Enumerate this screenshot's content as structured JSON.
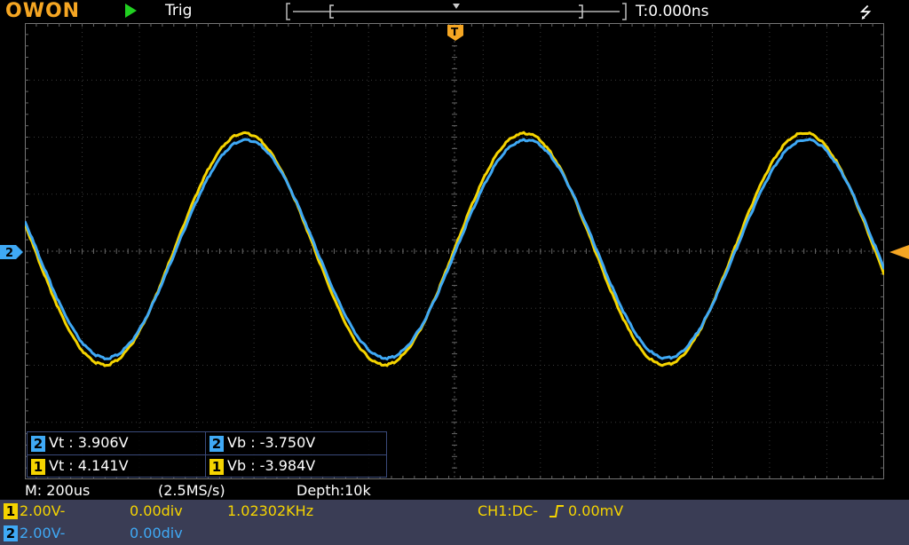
{
  "header": {
    "logo": "OWON",
    "status_icon": "run-triangle-icon",
    "trigger_label": "Trig",
    "trigger_time": "T:0.000ns",
    "usb_icon": "usb-icon",
    "trigger_marker": "T"
  },
  "timebase": {
    "scale": "M: 200us",
    "sample_rate": "(2.5MS/s)",
    "depth": "Depth:10k"
  },
  "channels": [
    {
      "id": "1",
      "scale": "2.00V-",
      "offset": "0.00div",
      "frequency": "1.02302KHz",
      "color": "#f5d400"
    },
    {
      "id": "2",
      "scale": "2.00V-",
      "offset": "0.00div",
      "color": "#3fa9f5"
    }
  ],
  "trigger_info": {
    "source": "CH1:DC-",
    "edge_icon": "rising-edge-icon",
    "level": "0.00mV"
  },
  "measurements": [
    {
      "channel": "2",
      "label": "Vt : 3.906V"
    },
    {
      "channel": "2",
      "label": "Vb : -3.750V"
    },
    {
      "channel": "1",
      "label": "Vt : 4.141V"
    },
    {
      "channel": "1",
      "label": "Vb : -3.984V"
    }
  ],
  "waveform": {
    "frequency_khz": 1.02302,
    "ch1_peak_v": 4.141,
    "ch1_trough_v": -3.984,
    "ch2_peak_v": 3.906,
    "ch2_trough_v": -3.75,
    "volts_per_div": 2.0,
    "time_per_div_us": 200,
    "ch1_color": "#f5d400",
    "ch2_color": "#3fa9f5"
  }
}
